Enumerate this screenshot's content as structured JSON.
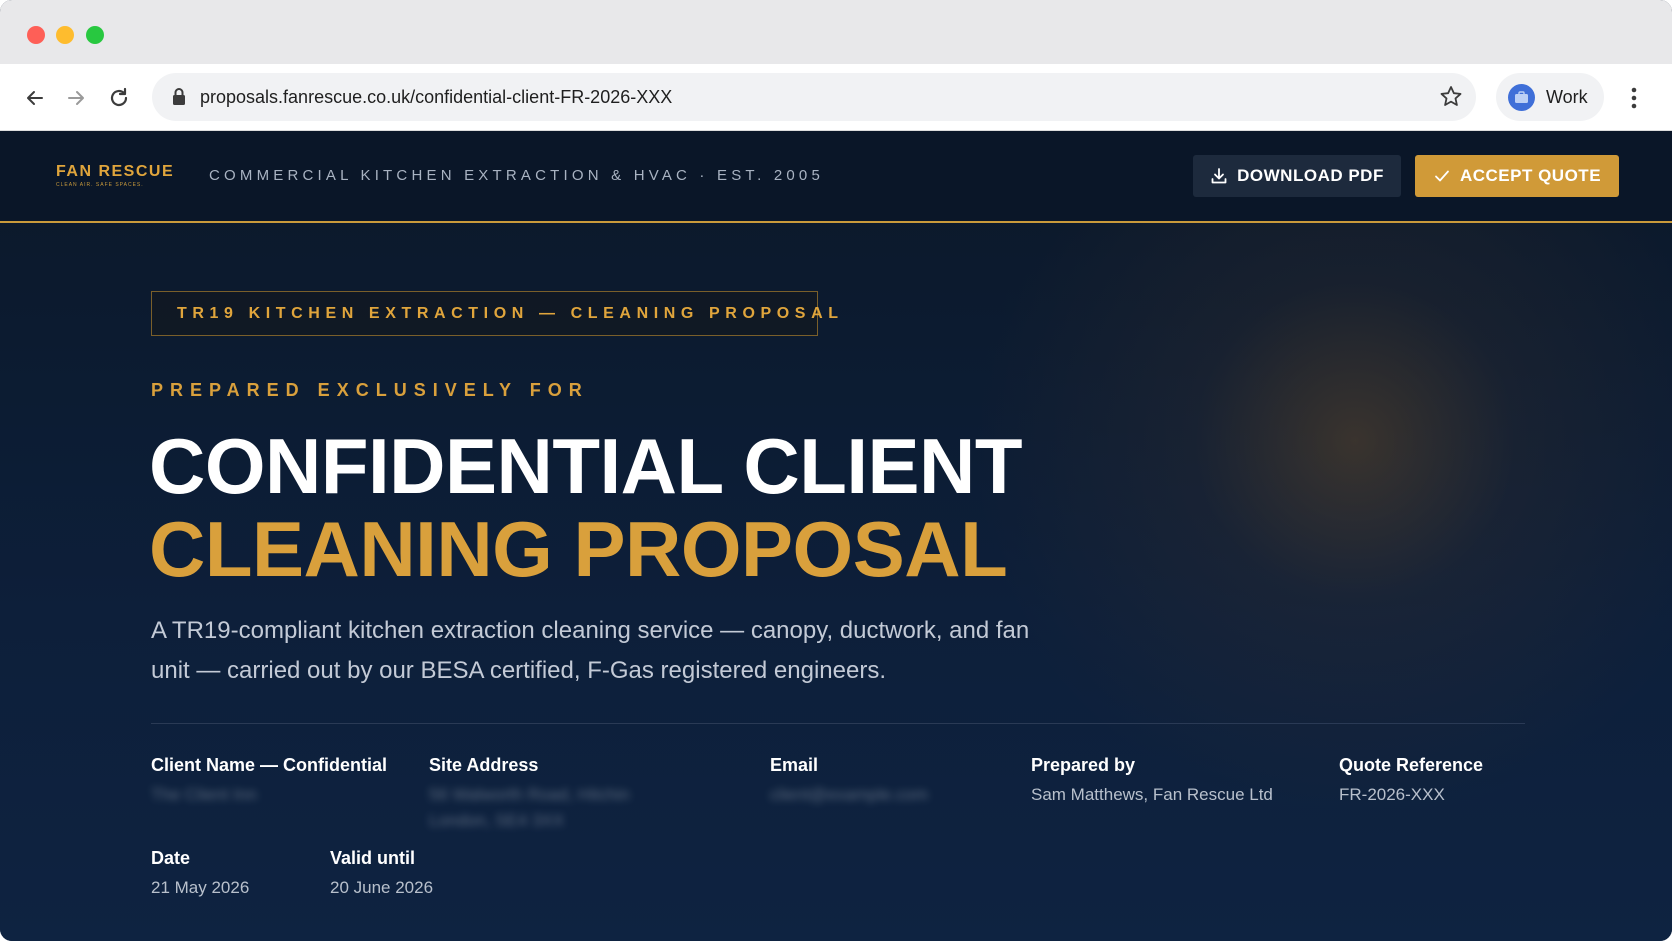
{
  "browser": {
    "url": "proposals.fanrescue.co.uk/confidential-client-FR-2026-XXX",
    "profile_label": "Work"
  },
  "header": {
    "brand_name": "FAN RESCUE",
    "brand_tagline": "CLEAN AIR. SAFE SPACES.",
    "strapline": "COMMERCIAL KITCHEN EXTRACTION & HVAC · EST. 2005",
    "download_label": "DOWNLOAD PDF",
    "accept_label": "ACCEPT QUOTE"
  },
  "hero": {
    "tag": "TR19 KITCHEN EXTRACTION — CLEANING PROPOSAL",
    "prepared_for": "PREPARED EXCLUSIVELY FOR",
    "title_line1": "CONFIDENTIAL CLIENT",
    "title_line2": "CLEANING PROPOSAL",
    "lede": "A TR19-compliant kitchen extraction cleaning service — canopy, ductwork, and fan unit — carried out by our BESA certified, F-Gas registered engineers."
  },
  "meta": {
    "client_name_label": "Client Name — Confidential",
    "client_name_value": "The Client Inn",
    "site_address_label": "Site Address",
    "site_address_line1": "56 Walworth Road, Hitchin",
    "site_address_line2": "London, SE4 3XX",
    "email_label": "Email",
    "email_value": "client@example.com",
    "prepared_by_label": "Prepared by",
    "prepared_by_value": "Sam Matthews, Fan Rescue Ltd",
    "quote_ref_label": "Quote Reference",
    "quote_ref_value": "FR-2026-XXX",
    "date_label": "Date",
    "date_value": "21 May 2026",
    "valid_until_label": "Valid until",
    "valid_until_value": "20 June 2026"
  },
  "colors": {
    "accent_gold": "#d9a03c",
    "navy": "#0b1a30"
  }
}
